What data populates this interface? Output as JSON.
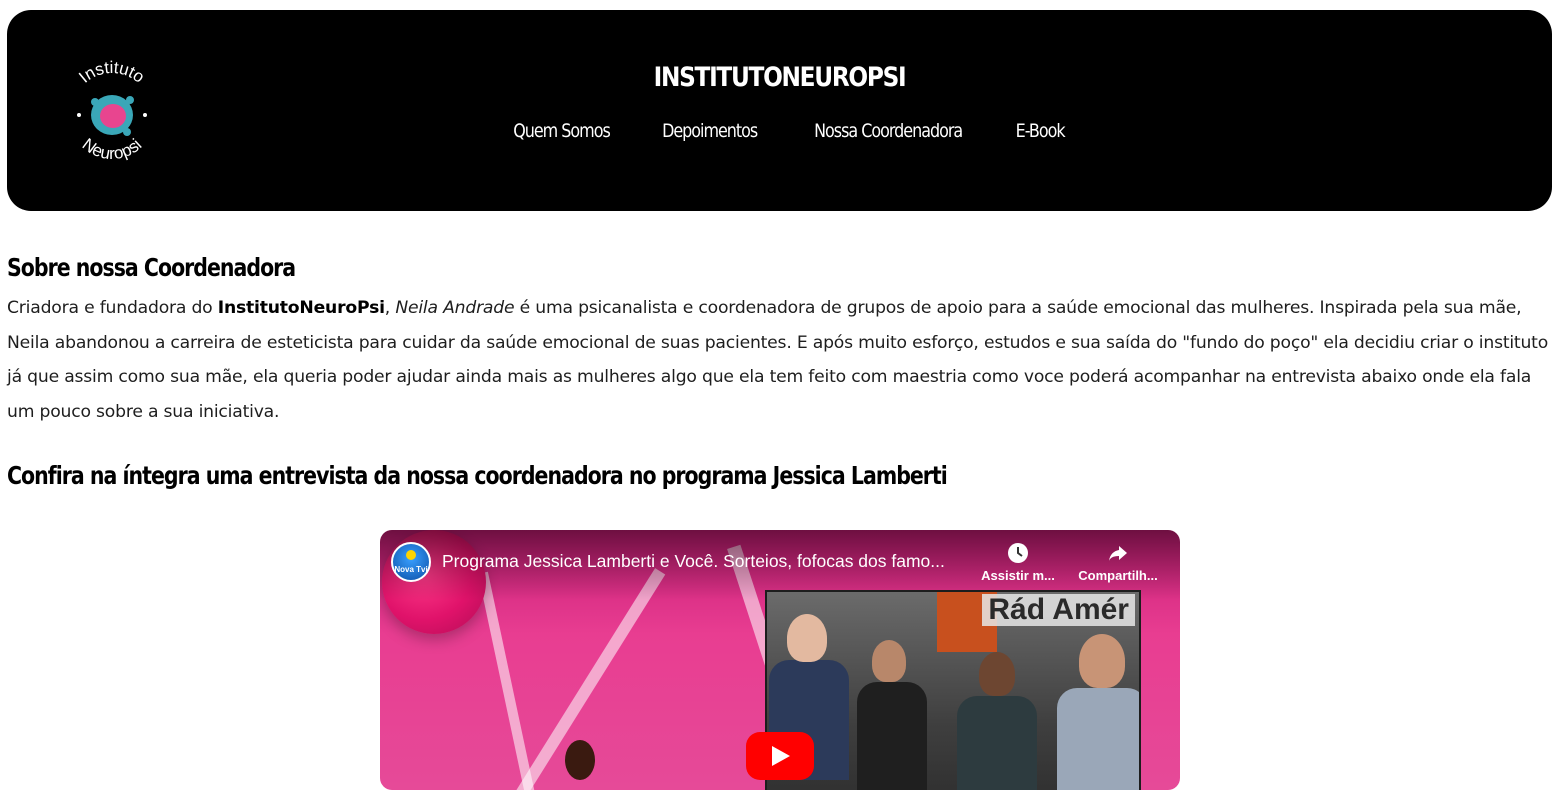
{
  "header": {
    "site_title": "INSTITUTONEUROPSI",
    "logo_text_top": "Instituto",
    "logo_text_bottom": "Neuropsi",
    "nav": [
      {
        "label": "Quem Somos"
      },
      {
        "label": "Depoimentos"
      },
      {
        "label": "Nossa Coordenadora"
      },
      {
        "label": "E-Book"
      }
    ]
  },
  "about": {
    "heading": "Sobre nossa Coordenadora",
    "intro_prefix": "Criadora e fundadora do ",
    "brand": "InstitutoNeuroPsi",
    "sep": ", ",
    "coordinator": "Neila Andrade",
    "body": " é uma psicanalista e coordenadora de grupos de apoio para a saúde emocional das mulheres. Inspirada pela sua mãe, Neila abandonou a carreira de esteticista para cuidar da saúde emocional de suas pacientes. E após muito esforço, estudos e sua saída do \"fundo do poço\" ela decidiu criar o instituto já que assim como sua mãe, ela queria poder ajudar ainda mais as mulheres algo que ela tem feito com maestria como voce poderá acompanhar na entrevista abaixo onde ela fala um pouco sobre a sua iniciativa."
  },
  "interview": {
    "heading": "Confira na íntegra uma entrevista da nossa coordenadora no programa Jessica Lamberti"
  },
  "video": {
    "channel_badge": "Nova Tvi",
    "title": "Programa Jessica Lamberti e Você. Sorteios, fofocas dos famo...",
    "watch_later": "Assistir m...",
    "share": "Compartilh...",
    "inset_sign": "Rád Amér"
  },
  "colors": {
    "header_bg": "#000000",
    "video_pink": "#e83d91",
    "play_red": "#ff0000"
  }
}
